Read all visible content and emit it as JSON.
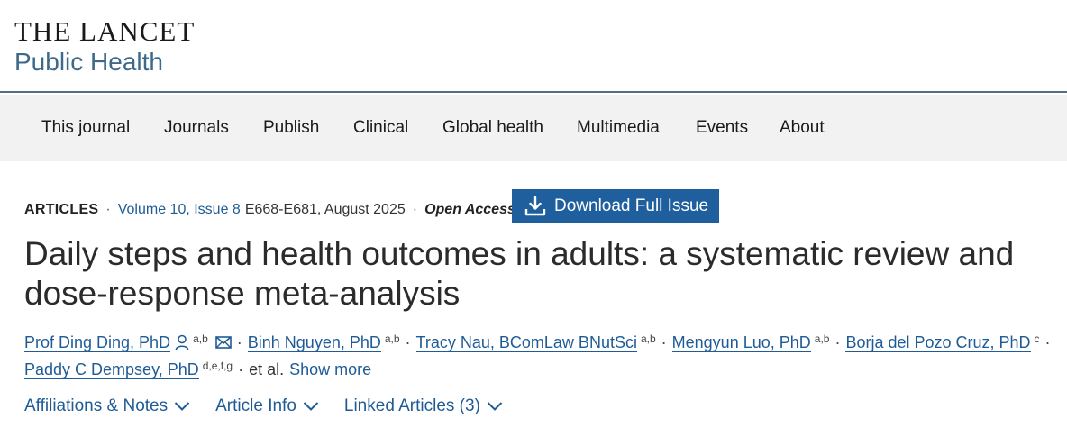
{
  "brand": {
    "line1": "THE LANCET",
    "line2": "Public Health"
  },
  "nav": {
    "items": [
      "This journal",
      "Journals",
      "Publish",
      "Clinical",
      "Global health",
      "Multimedia",
      "Events",
      "About"
    ]
  },
  "article": {
    "type": "ARTICLES",
    "volume_issue": "Volume 10, Issue 8",
    "pages_date": "E668-E681, August 2025",
    "access": "Open Access",
    "download_label": "Download Full Issue",
    "title": "Daily steps and health outcomes in adults: a systematic review and dose-response meta-analysis"
  },
  "authors": [
    {
      "name": "Prof Ding Ding, PhD",
      "affil": "a,b"
    },
    {
      "name": "Binh Nguyen, PhD",
      "affil": "a,b"
    },
    {
      "name": "Tracy Nau, BComLaw BNutSci",
      "affil": "a,b"
    },
    {
      "name": "Mengyun Luo, PhD",
      "affil": "a,b"
    },
    {
      "name": "Borja del Pozo Cruz, PhD",
      "affil": "c"
    },
    {
      "name": "Paddy C Dempsey, PhD",
      "affil": "d,e,f,g"
    }
  ],
  "authors_extra": {
    "etal": "et al.",
    "show_more": "Show more"
  },
  "tabs": [
    "Affiliations & Notes",
    "Article Info",
    "Linked Articles (3)"
  ],
  "colors": {
    "link": "#1f5c96",
    "button": "#1f5f9e",
    "navbar_bg": "#f2f2f2",
    "rule": "#536d85"
  },
  "icons": {
    "download": "download-icon",
    "person": "person-icon",
    "email": "email-icon",
    "chevron": "chevron-down-icon"
  }
}
